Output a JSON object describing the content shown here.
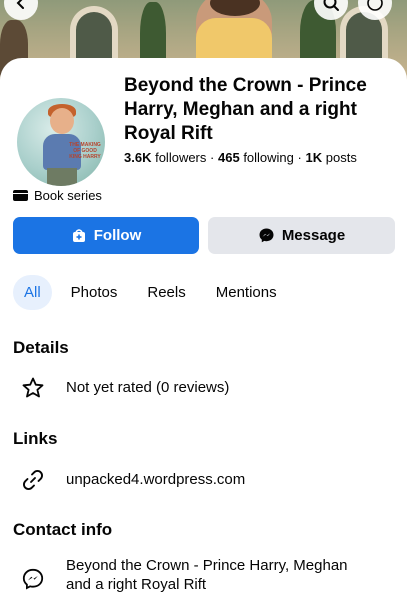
{
  "page": {
    "title": "Beyond the Crown - Prince Harry, Meghan and a right Royal Rift",
    "stats": {
      "followers_count": "3.6K",
      "followers_label": "followers",
      "following_count": "465",
      "following_label": "following",
      "posts_count": "1K",
      "posts_label": "posts",
      "separator": "·"
    },
    "category": "Book series",
    "avatar_text": "THE MAKING OF GOOD KING HARRY"
  },
  "actions": {
    "follow_label": "Follow",
    "message_label": "Message"
  },
  "tabs": [
    {
      "label": "All",
      "active": true
    },
    {
      "label": "Photos",
      "active": false
    },
    {
      "label": "Reels",
      "active": false
    },
    {
      "label": "Mentions",
      "active": false
    }
  ],
  "details": {
    "title": "Details",
    "rating": "Not yet rated (0 reviews)"
  },
  "links": {
    "title": "Links",
    "website": "unpacked4.wordpress.com"
  },
  "contact": {
    "title": "Contact info",
    "messenger_line1": "Beyond the Crown - Prince Harry, Meghan",
    "messenger_line2": "and a right Royal Rift"
  },
  "colors": {
    "accent": "#1b74e4",
    "secondary_button": "#e4e6eb",
    "active_tab_bg": "#e7f0fd",
    "text": "#050505"
  },
  "icons": {
    "back": "chevron-left-icon",
    "search": "search-icon",
    "more": "more-icon",
    "category": "clapperboard-icon",
    "follow": "follow-plus-icon",
    "message": "messenger-icon",
    "rating": "star-icon",
    "link": "link-icon",
    "contact": "messenger-icon"
  }
}
